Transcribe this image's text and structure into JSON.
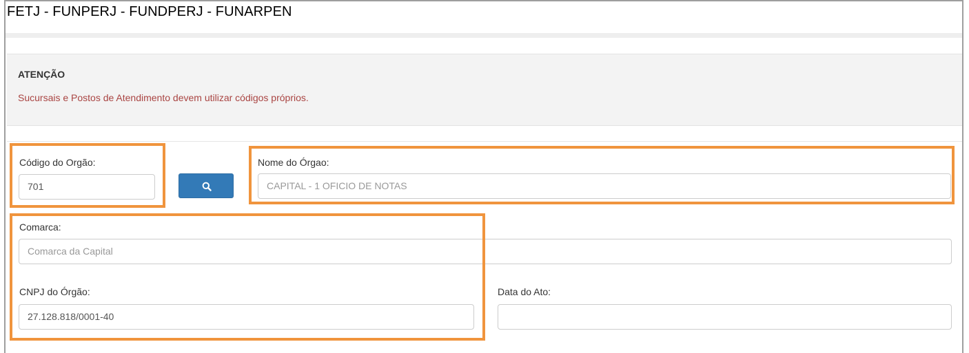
{
  "header": {
    "title": "FETJ - FUNPERJ - FUNDPERJ - FUNARPEN"
  },
  "alert": {
    "title": "ATENÇÃO",
    "message": "Sucursais e Postos de Atendimento devem utilizar códigos próprios."
  },
  "form": {
    "codigo": {
      "label": "Código do Orgão:",
      "value": "701"
    },
    "search_button": {
      "icon": "search-icon"
    },
    "nome": {
      "label": "Nome do Órgao:",
      "value": "CAPITAL - 1 OFICIO DE NOTAS"
    },
    "comarca": {
      "label": "Comarca:",
      "value": "Comarca da Capital"
    },
    "cnpj": {
      "label": "CNPJ do Órgão:",
      "value": "27.128.818/0001-40"
    },
    "data_ato": {
      "label": "Data do Ato:",
      "value": ""
    }
  },
  "colors": {
    "highlight": "#f0943d",
    "primary_button": "#337ab7",
    "alert_text": "#a94442"
  }
}
